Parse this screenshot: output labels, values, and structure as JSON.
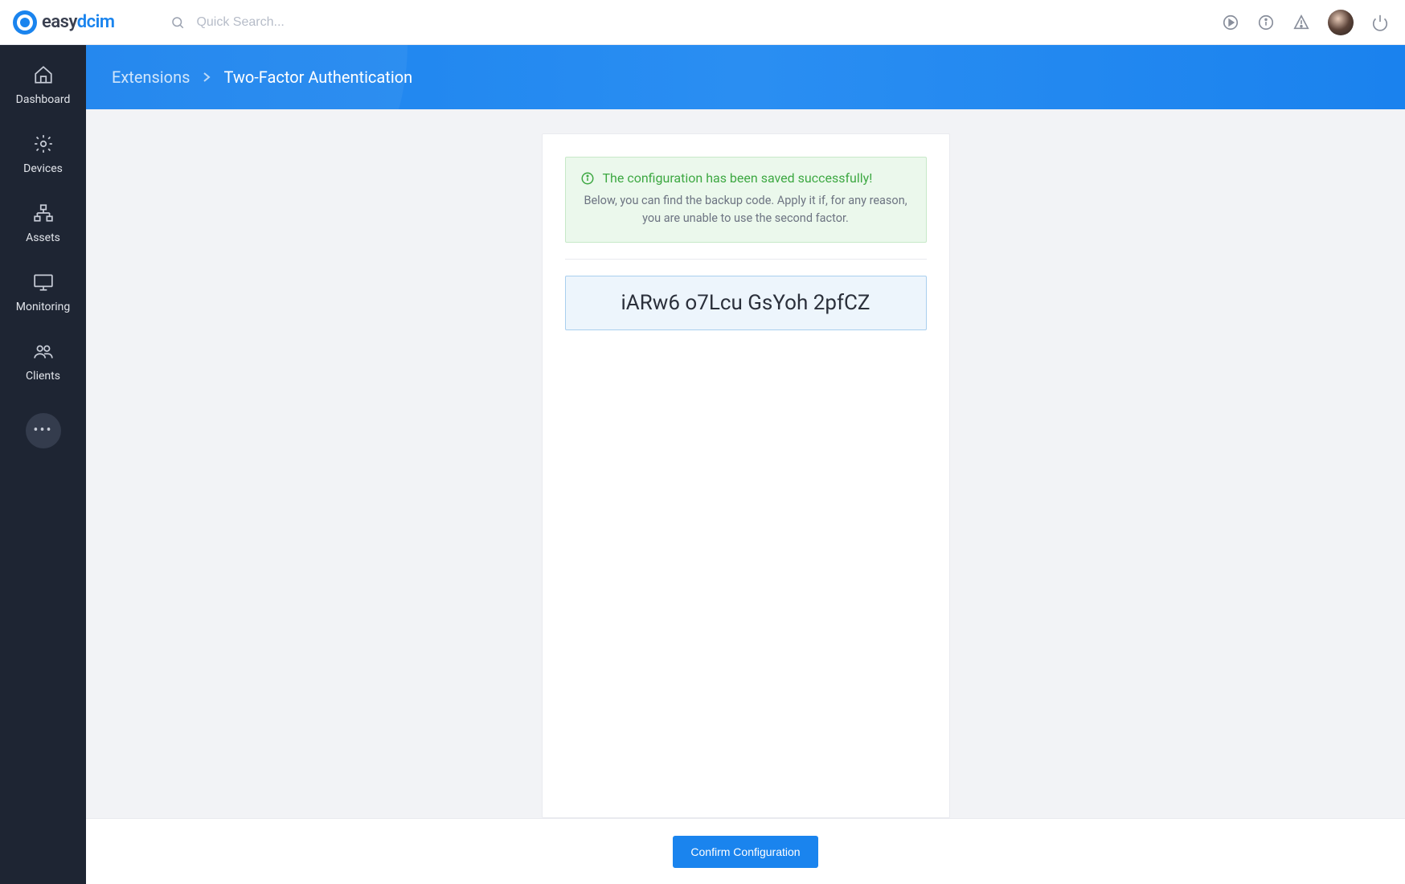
{
  "brand": {
    "name_part1": "easy",
    "name_part2": "dcim"
  },
  "search": {
    "placeholder": "Quick Search..."
  },
  "sidebar": {
    "items": [
      {
        "label": "Dashboard"
      },
      {
        "label": "Devices"
      },
      {
        "label": "Assets"
      },
      {
        "label": "Monitoring"
      },
      {
        "label": "Clients"
      }
    ]
  },
  "breadcrumb": {
    "parent": "Extensions",
    "current": "Two-Factor Authentication"
  },
  "alert": {
    "title": "The configuration has been saved successfully!",
    "subtitle": "Below, you can find the backup code. Apply it if, for any reason, you are unable to use the second factor."
  },
  "backup_code": "iARw6 o7Lcu GsYoh 2pfCZ",
  "footer": {
    "confirm_label": "Confirm Configuration"
  }
}
